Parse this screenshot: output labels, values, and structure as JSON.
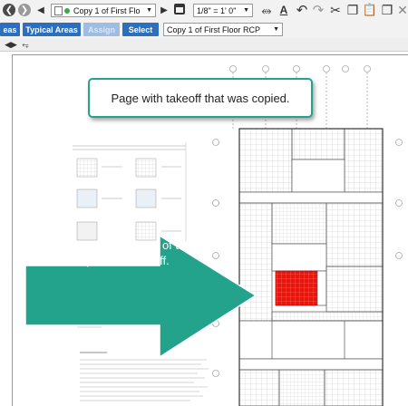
{
  "toolbar": {
    "page_select_value": "Copy 1 of First Flo",
    "scale_value": "1/8\" = 1' 0\"",
    "areas_label": "eas",
    "typical_areas_label": "Typical Areas",
    "assign_label": "Assign",
    "select_label": "Select",
    "area_select_value": "Copy 1 of First Floor RCP"
  },
  "callout": {
    "top_text": "Page with takeoff that was copied."
  },
  "arrow": {
    "line1": "Notice the position of this",
    "line2": "piece of takeoff."
  },
  "colors": {
    "teal": "#23a38c",
    "takeoff_red": "#e8150c",
    "button_blue": "#2c6fbd"
  }
}
